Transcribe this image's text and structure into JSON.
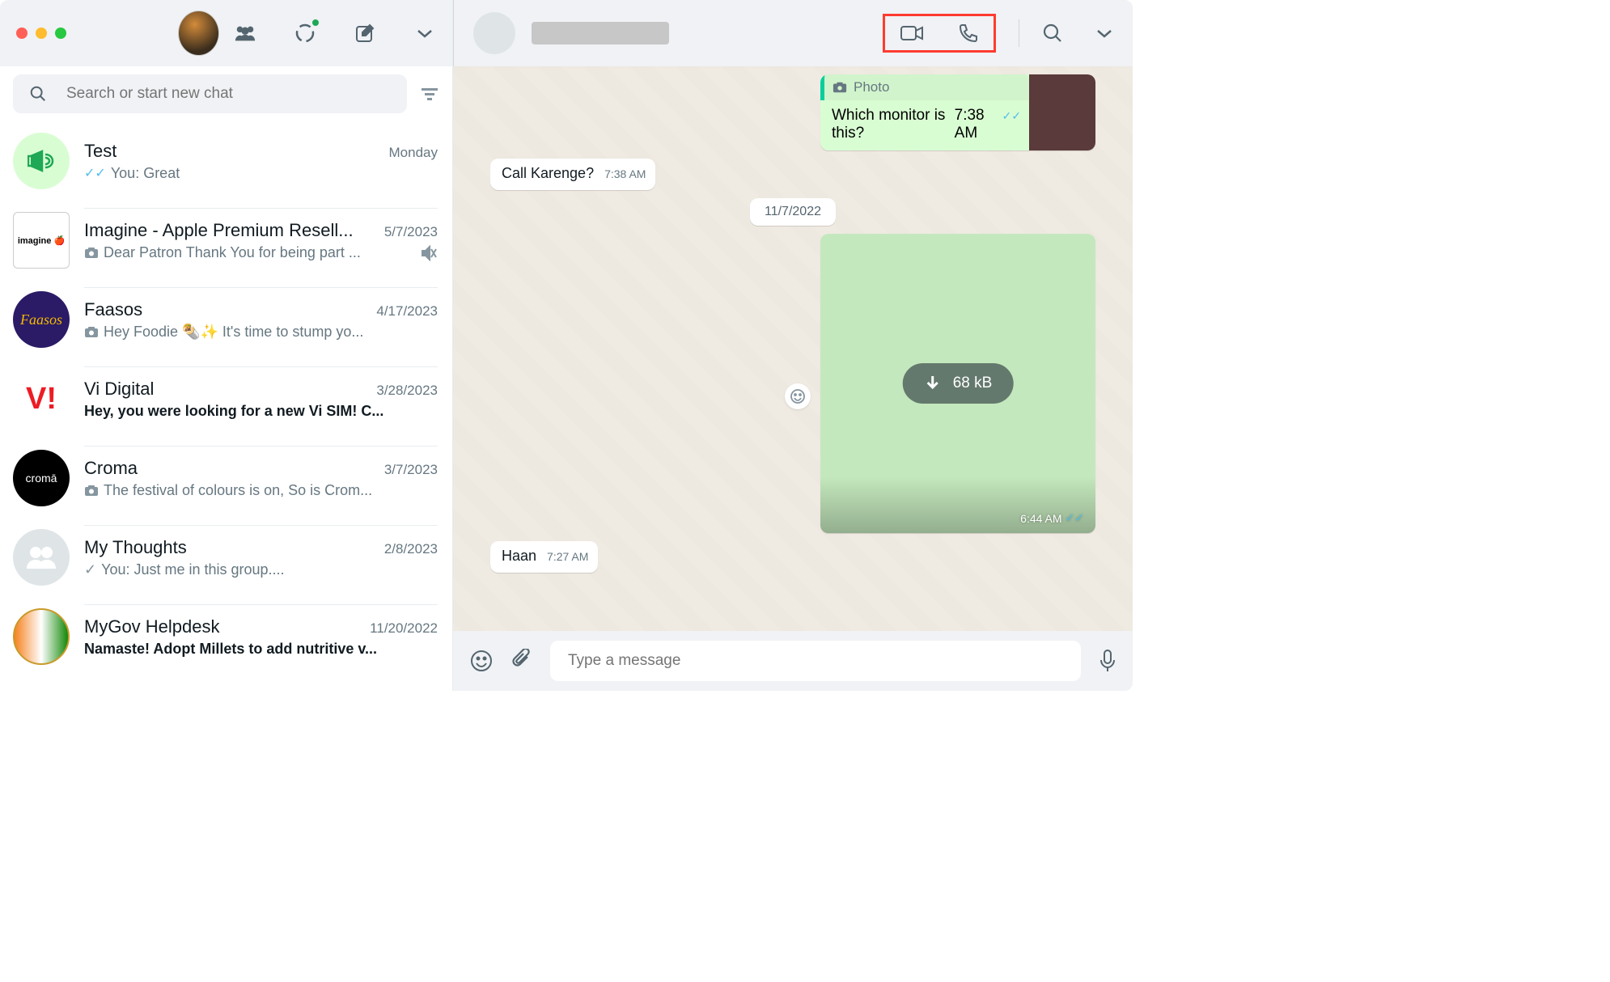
{
  "search": {
    "placeholder": "Search or start new chat"
  },
  "chats": [
    {
      "name": "Test",
      "time": "Monday",
      "snippet": "You: Great",
      "hasTick": true,
      "avatar": "announce"
    },
    {
      "name": "Imagine - Apple Premium Resell...",
      "time": "5/7/2023",
      "snippet": "Dear Patron Thank You for being part ...",
      "hasCam": true,
      "muted": true,
      "avatar": "imagine"
    },
    {
      "name": "Faasos",
      "time": "4/17/2023",
      "snippet": "Hey Foodie 🌯✨ It's time to stump yo...",
      "hasCam": true,
      "avatar": "faasos"
    },
    {
      "name": "Vi Digital",
      "time": "3/28/2023",
      "snippet": "Hey, you were looking for a new Vi SIM! C...",
      "bold": true,
      "avatar": "vi"
    },
    {
      "name": "Croma",
      "time": "3/7/2023",
      "snippet": "The festival of colours is on,  So is Crom...",
      "hasCam": true,
      "avatar": "croma"
    },
    {
      "name": "My Thoughts",
      "time": "2/8/2023",
      "snippet": "You: Just me in this group....",
      "hasSingleTick": true,
      "avatar": "group"
    },
    {
      "name": "MyGov Helpdesk",
      "time": "11/20/2022",
      "snippet": "Namaste! Adopt Millets to add nutritive v...",
      "bold": true,
      "avatar": "mygov"
    }
  ],
  "messages": {
    "photoCard": {
      "label": "Photo",
      "text": "Which monitor is this?",
      "time": "7:38 AM"
    },
    "in1": {
      "text": "Call Karenge?",
      "time": "7:38 AM"
    },
    "dateDivider": "11/7/2022",
    "media": {
      "size": "68 kB",
      "time": "6:44 AM"
    },
    "in2": {
      "text": "Haan",
      "time": "7:27 AM"
    }
  },
  "composer": {
    "placeholder": "Type a message"
  }
}
